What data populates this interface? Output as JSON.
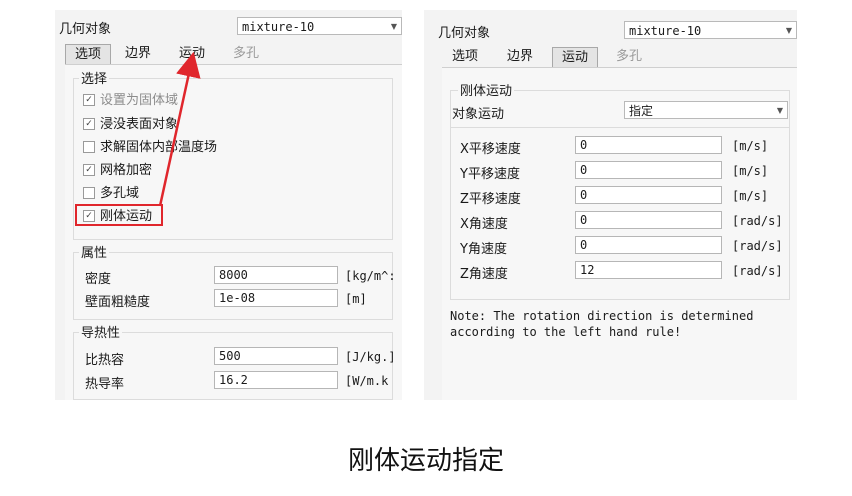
{
  "left": {
    "object_label": "几何对象",
    "object_value": "mixture-10",
    "tabs": [
      {
        "label": "选项",
        "selected": true
      },
      {
        "label": "边界",
        "selected": false
      },
      {
        "label": "运动",
        "selected": false
      },
      {
        "label": "多孔",
        "disabled": true
      }
    ],
    "select_group": {
      "title": "选择",
      "items": [
        {
          "label": "设置为固体域",
          "checked": true,
          "disabled": true
        },
        {
          "label": "浸没表面对象",
          "checked": true
        },
        {
          "label": "求解固体内部温度场",
          "checked": false
        },
        {
          "label": "网格加密",
          "checked": true
        },
        {
          "label": "多孔域",
          "checked": false
        },
        {
          "label": "刚体运动",
          "checked": true
        }
      ]
    },
    "property_group": {
      "title": "属性",
      "rows": [
        {
          "label": "密度",
          "value": "8000",
          "unit": "[kg/m^:"
        },
        {
          "label": "壁面粗糙度",
          "value": "1e-08",
          "unit": "[m]"
        }
      ]
    },
    "thermal_group": {
      "title": "导热性",
      "rows": [
        {
          "label": "比热容",
          "value": "500",
          "unit": "[J/kg.]"
        },
        {
          "label": "热导率",
          "value": "16.2",
          "unit": "[W/m.k"
        }
      ]
    }
  },
  "right": {
    "object_label": "几何对象",
    "object_value": "mixture-10",
    "tabs": [
      {
        "label": "选项",
        "selected": false
      },
      {
        "label": "边界",
        "selected": false
      },
      {
        "label": "运动",
        "selected": true
      },
      {
        "label": "多孔",
        "disabled": true
      }
    ],
    "rigid_group": {
      "title": "刚体运动",
      "motion_label": "对象运动",
      "motion_value": "指定",
      "rows": [
        {
          "label": "X平移速度",
          "value": "0",
          "unit": "[m/s]"
        },
        {
          "label": "Y平移速度",
          "value": "0",
          "unit": "[m/s]"
        },
        {
          "label": "Z平移速度",
          "value": "0",
          "unit": "[m/s]"
        },
        {
          "label": "X角速度",
          "value": "0",
          "unit": "[rad/s]"
        },
        {
          "label": "Y角速度",
          "value": "0",
          "unit": "[rad/s]"
        },
        {
          "label": "Z角速度",
          "value": "12",
          "unit": "[rad/s]"
        }
      ]
    },
    "note_line1": "Note: The rotation direction is determined",
    "note_line2": "according to the left hand rule!"
  },
  "caption": "刚体运动指定",
  "colors": {
    "highlight": "#e0262c",
    "panel_bg": "#f3f3f3"
  }
}
